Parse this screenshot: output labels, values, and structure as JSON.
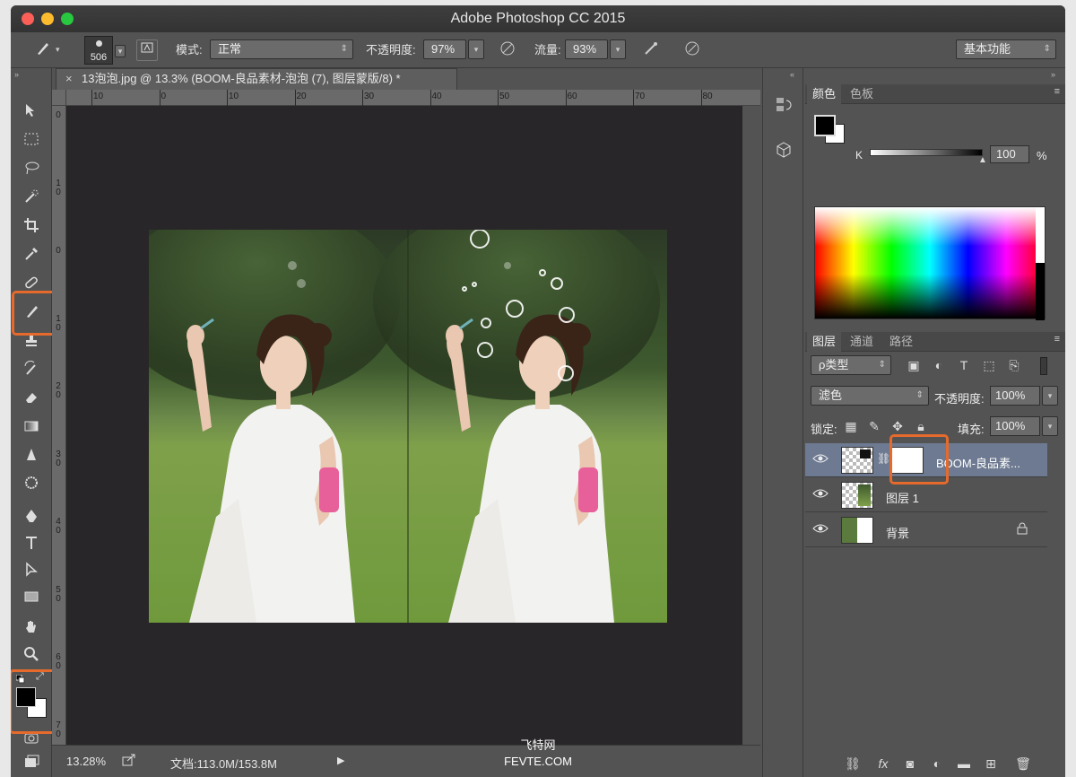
{
  "window": {
    "title": "Adobe Photoshop CC 2015"
  },
  "options_bar": {
    "brush_size": "506",
    "mode_label": "模式:",
    "mode_value": "正常",
    "opacity_label": "不透明度:",
    "opacity_value": "97%",
    "flow_label": "流量:",
    "flow_value": "93%",
    "workspace": "基本功能"
  },
  "document": {
    "tab_title": "13泡泡.jpg @ 13.3% (BOOM-良品素材-泡泡 (7), 图层蒙版/8) *",
    "close_glyph": "×",
    "ruler_h": [
      "10",
      "0",
      "10",
      "20",
      "30",
      "40",
      "50",
      "60",
      "70",
      "80"
    ],
    "ruler_v": [
      "0",
      "10",
      "0",
      "10",
      "20",
      "30",
      "40",
      "50",
      "60",
      "70"
    ]
  },
  "status": {
    "zoom": "13.28%",
    "doc_size": "文档:113.0M/153.8M"
  },
  "color_panel": {
    "tabs": [
      "颜色",
      "色板"
    ],
    "channel": "K",
    "value": "100",
    "unit": "%"
  },
  "layers_panel": {
    "tabs": [
      "图层",
      "通道",
      "路径"
    ],
    "filter": "ρ类型",
    "blend_mode": "滤色",
    "opacity_label": "不透明度:",
    "opacity_value": "100%",
    "lock_label": "锁定:",
    "fill_label": "填充:",
    "fill_value": "100%",
    "layers": [
      {
        "name": "BOOM-良品素..."
      },
      {
        "name": "图层 1"
      },
      {
        "name": "背景"
      }
    ]
  },
  "watermark": {
    "line1": "飞特网",
    "line2": "FEVTE.COM"
  },
  "colors": {
    "accent_highlight": "#e56a2c",
    "selected_layer": "#6d7a91"
  }
}
